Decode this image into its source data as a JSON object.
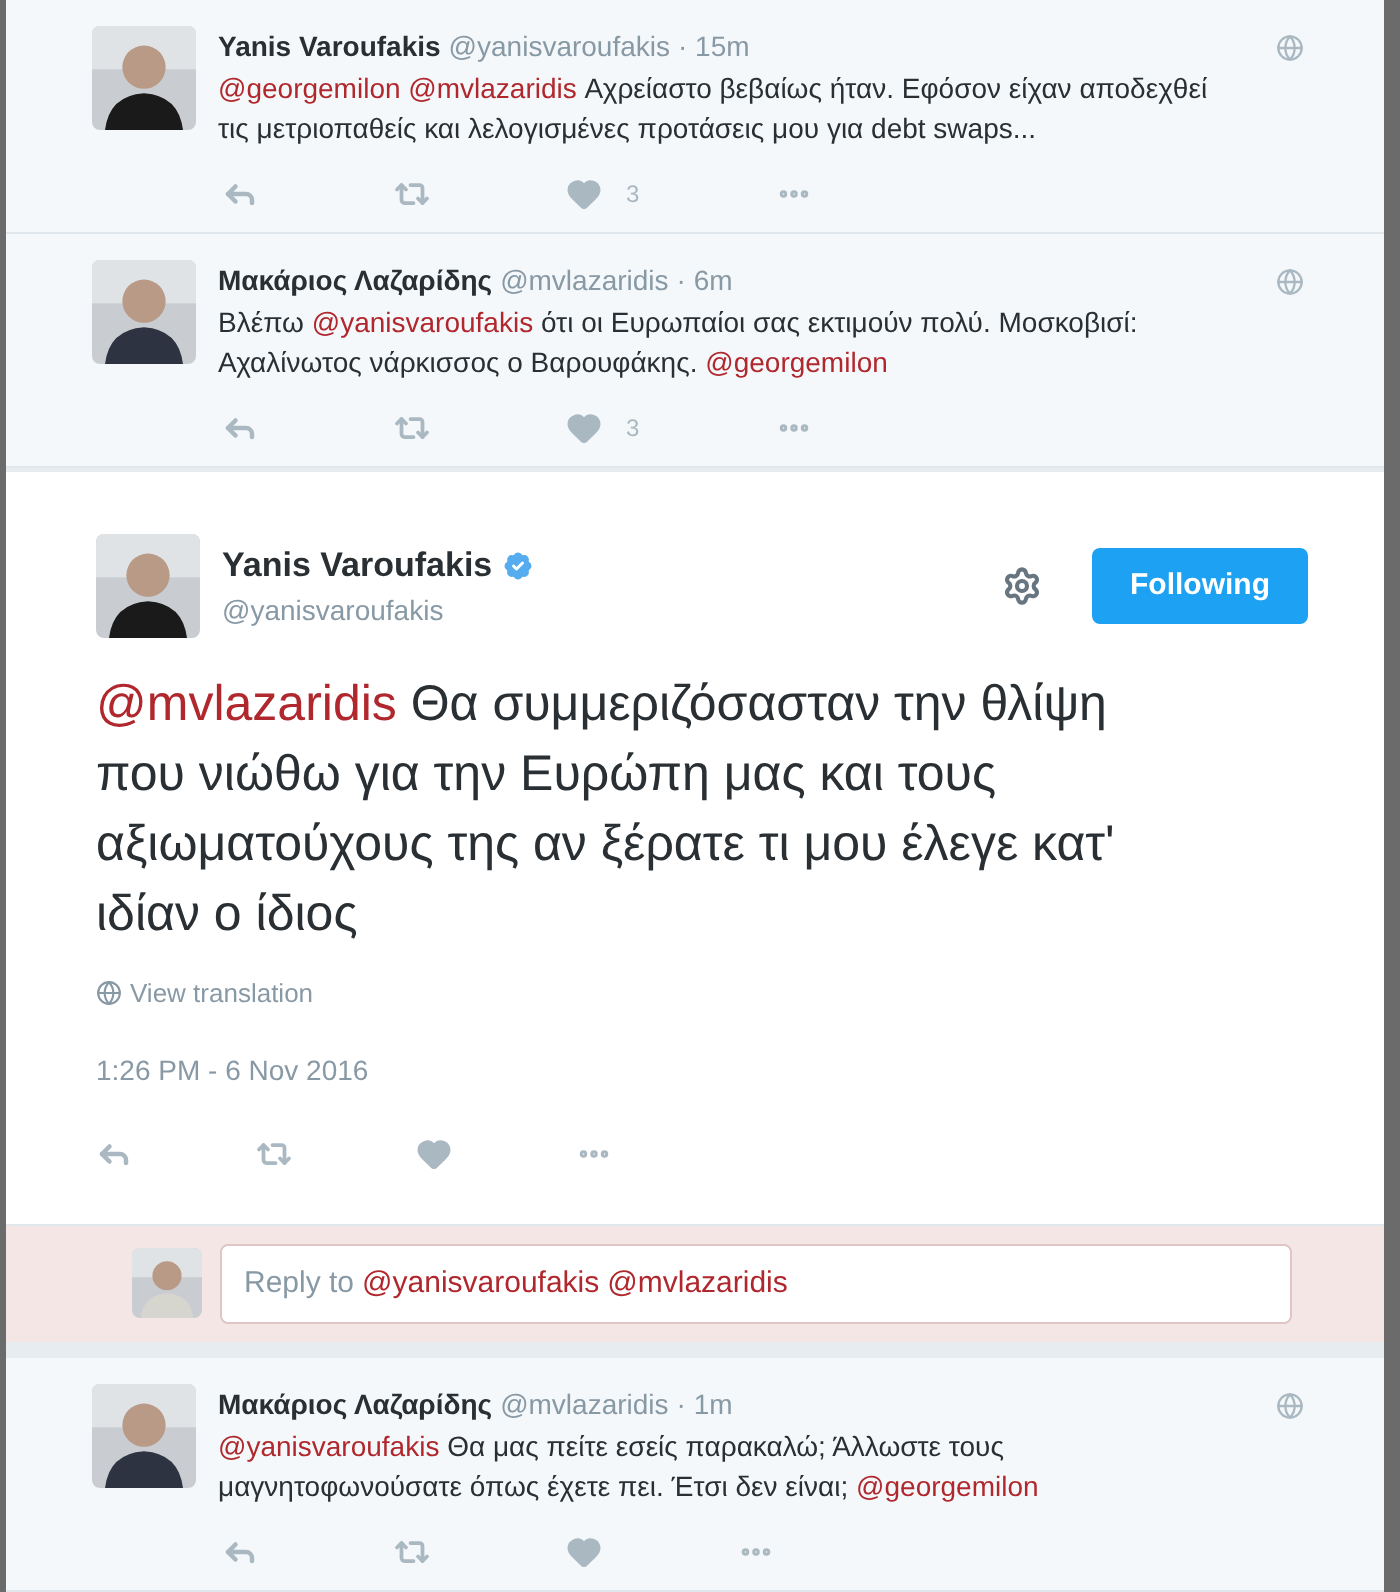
{
  "replies_above": [
    {
      "name": "Yanis Varoufakis",
      "handle": "@yanisvaroufakis",
      "time": "· 15m",
      "body": [
        {
          "kind": "mention",
          "text": "@georgemilon @mvlazaridis"
        },
        {
          "kind": "text",
          "text": " Αχρείαστο βεβαίως ήταν. Εφόσον είχαν αποδεχθεί τις μετριοπαθείς και λελογισμένες προτάσεις μου για debt swaps..."
        }
      ],
      "likes": "3"
    },
    {
      "name": "Μακάριος Λαζαρίδης",
      "handle": "@mvlazaridis",
      "time": "· 6m",
      "body": [
        {
          "kind": "text",
          "text": "Βλέπω "
        },
        {
          "kind": "mention",
          "text": "@yanisvaroufakis"
        },
        {
          "kind": "text",
          "text": " ότι οι Ευρωπαίοι σας εκτιμούν πολύ. Μοσκοβισί: Αχαλίνωτος νάρκισσος ο Βαρουφάκης. "
        },
        {
          "kind": "mention",
          "text": "@georgemilon"
        }
      ],
      "likes": "3"
    }
  ],
  "main_tweet": {
    "name": "Yanis Varoufakis",
    "verified": true,
    "handle": "@yanisvaroufakis",
    "follow_button": "Following",
    "body": [
      {
        "kind": "mention",
        "text": "@mvlazaridis"
      },
      {
        "kind": "text",
        "text": " Θα συμμεριζόσασταν την θλίψη που νιώθω για την Ευρώπη μας και τους αξιωματούχους της αν ξέρατε τι μου έλεγε κατ' ιδίαν ο ίδιος"
      }
    ],
    "view_translation": "View translation",
    "timestamp": "1:26 PM - 6 Nov 2016"
  },
  "reply_box": {
    "placeholder": "Reply to",
    "mentions": [
      "@yanisvaroufakis",
      "@mvlazaridis"
    ]
  },
  "replies_below": [
    {
      "name": "Μακάριος Λαζαρίδης",
      "handle": "@mvlazaridis",
      "time": "· 1m",
      "body": [
        {
          "kind": "mention",
          "text": "@yanisvaroufakis"
        },
        {
          "kind": "text",
          "text": " Θα μας πείτε εσείς παρακαλώ; Άλλωστε τους μαγνητοφωνούσατε όπως έχετε πει. Έτσι δεν είναι; "
        },
        {
          "kind": "mention",
          "text": "@georgemilon"
        }
      ]
    }
  ]
}
